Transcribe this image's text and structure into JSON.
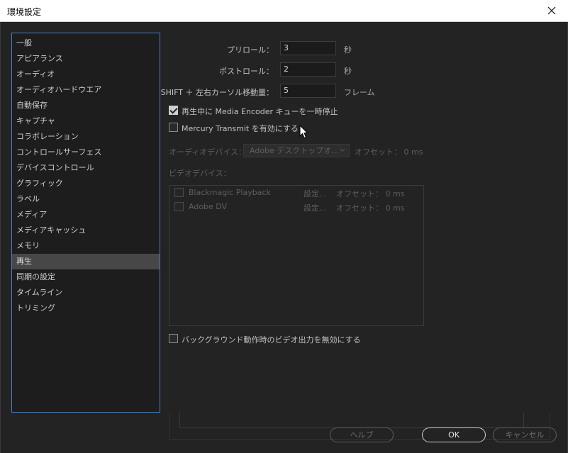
{
  "window": {
    "title": "環境設定"
  },
  "sidebar": {
    "items": [
      {
        "label": "一般"
      },
      {
        "label": "アピアランス"
      },
      {
        "label": "オーディオ"
      },
      {
        "label": "オーディオハードウエア"
      },
      {
        "label": "自動保存"
      },
      {
        "label": "キャプチャ"
      },
      {
        "label": "コラボレーション"
      },
      {
        "label": "コントロールサーフェス"
      },
      {
        "label": "デバイスコントロール"
      },
      {
        "label": "グラフィック"
      },
      {
        "label": "ラベル"
      },
      {
        "label": "メディア"
      },
      {
        "label": "メディアキャッシュ"
      },
      {
        "label": "メモリ"
      },
      {
        "label": "再生"
      },
      {
        "label": "同期の設定"
      },
      {
        "label": "タイムライン"
      },
      {
        "label": "トリミング"
      }
    ],
    "selected": "再生"
  },
  "playback": {
    "preroll_label": "プリロール：",
    "preroll_value": "3",
    "preroll_unit": "秒",
    "postroll_label": "ポストロール：",
    "postroll_value": "2",
    "postroll_unit": "秒",
    "shift_label": "SHIFT ＋ 左右カーソル移動量：",
    "shift_value": "5",
    "shift_unit": "フレーム",
    "pause_encoder_label": "再生中に Media Encoder キューを一時停止",
    "pause_encoder_checked": true,
    "mercury_label": "Mercury Transmit を有効にする",
    "mercury_checked": false,
    "audio_device_label": "オーディオデバイス：",
    "audio_device_value": "Adobe デスクトップオ...",
    "audio_offset": "オフセット： 0 ms",
    "video_device_label": "ビデオデバイス：",
    "video_devices": [
      {
        "name": "Blackmagic Playback",
        "settings": "設定...",
        "offset": "オフセット： 0 ms"
      },
      {
        "name": "Adobe DV",
        "settings": "設定...",
        "offset": "オフセット： 0 ms"
      }
    ],
    "background_disable_label": "バックグラウンド動作時のビデオ出力を無効にする",
    "background_disable_checked": false
  },
  "buttons": {
    "help": "ヘルプ",
    "ok": "OK",
    "cancel": "キャンセル"
  },
  "colors": {
    "background": "#232323",
    "panel": "#1d1d1d",
    "selection": "#474747",
    "focus_border": "#4a7fc0"
  },
  "icons": {
    "close": "close-icon",
    "checkbox": "checkbox",
    "cursor": "mouse-pointer-icon",
    "dropdown": "chevron-down-icon"
  }
}
